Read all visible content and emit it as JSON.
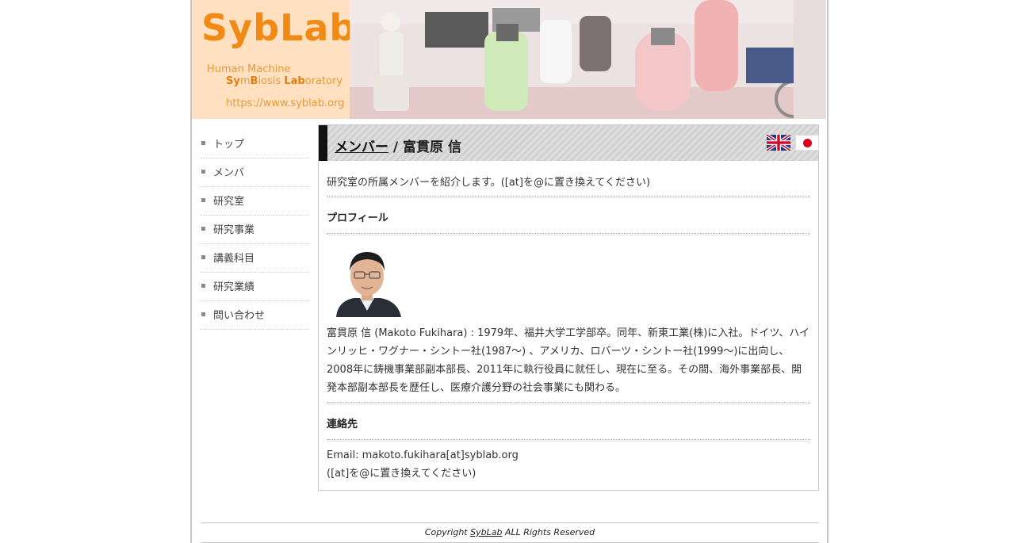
{
  "header": {
    "logo_title": "SybLab",
    "logo_line1": "Human Machine",
    "logo_line2_parts": [
      "Sy",
      "m",
      "B",
      "iosis ",
      "Lab",
      "oratory"
    ],
    "logo_url": "https://www.syblab.org"
  },
  "sidebar": {
    "items": [
      {
        "label": "トップ"
      },
      {
        "label": "メンバ"
      },
      {
        "label": "研究室"
      },
      {
        "label": "研究事業"
      },
      {
        "label": "講義科目"
      },
      {
        "label": "研究業績"
      },
      {
        "label": "問い合わせ"
      }
    ]
  },
  "main": {
    "title_link": "メンバー",
    "title_rest": " / 富貫原 信",
    "intro": "研究室の所属メンバーを紹介します。([at]を@に置き換えてください)",
    "profile_heading": "プロフィール",
    "bio": "富貫原 信 (Makoto Fukihara) : 1979年、福井大学工学部卒。同年、新東工業(株)に入社。ドイツ、ハインリッヒ・ワグナー・シントー社(1987～) 、アメリカ、ロバーツ・シントー社(1999～)に出向し、2008年に鋳機事業部副本部長、2011年に執行役員に就任し、現在に至る。その間、海外事業部長、開発本部副本部長を歴任し、医療介護分野の社会事業にも関わる。",
    "contact_heading": "連絡先",
    "email_line": "Email: makoto.fukihara[at]syblab.org",
    "email_note": "([at]を@に置き換えてください)"
  },
  "footer": {
    "copyright_prefix": "Copyright ",
    "copyright_link": "SybLab",
    "copyright_suffix": " ALL Rights Reserved"
  },
  "colors": {
    "logo_orange": "#f08a14",
    "logo_bg": "#ffe0c0",
    "head_bar": "#111111"
  }
}
